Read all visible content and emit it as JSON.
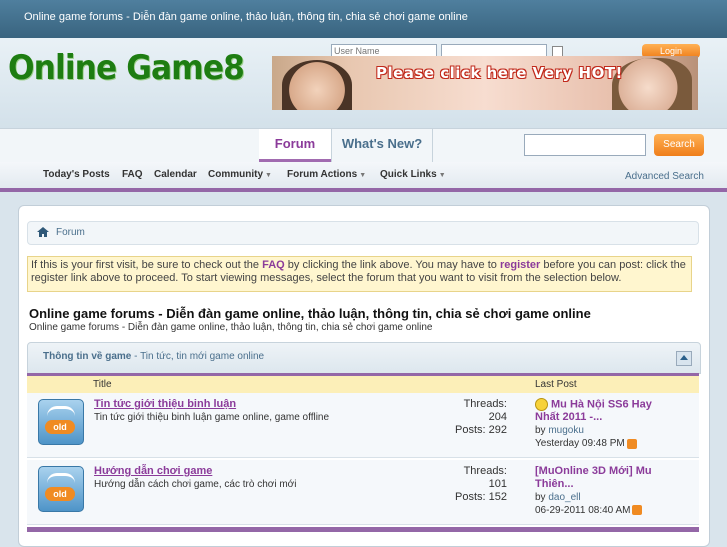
{
  "topbar": {
    "title": "Online game forums - Diễn đàn game online, thảo luận, thông tin, chia sẻ chơi game online"
  },
  "header": {
    "logo": "Online Game8",
    "username_placeholder": "User Name",
    "login_label": "Login",
    "banner_text": "Please click here Very HOT!"
  },
  "nav": {
    "tabs": [
      {
        "label": "Forum"
      },
      {
        "label": "What's New?"
      }
    ],
    "search_label": "Search",
    "subnav": [
      "Today's Posts",
      "FAQ",
      "Calendar",
      "Community",
      "Forum Actions",
      "Quick Links"
    ],
    "advanced_search": "Advanced Search"
  },
  "breadcrumb": {
    "label": "Forum"
  },
  "notice": {
    "part1": "If this is your first visit, be sure to check out the ",
    "faq": "FAQ",
    "part2": " by clicking the link above. You may have to ",
    "register": "register",
    "part3": " before you can post: click the register link above to proceed. To start viewing messages, select the forum that you want to visit from the selection below."
  },
  "page": {
    "title": "Online game forums - Diễn đàn game online, thảo luận, thông tin, chia sẻ chơi game online",
    "subtitle": "Online game forums - Diễn đàn game online, thảo luận, thông tin, chia sẻ chơi game online"
  },
  "category": {
    "name": "Thông tin về game",
    "separator": " - ",
    "desc": "Tin tức, tin mới game online"
  },
  "table": {
    "col_title": "Title",
    "col_last": "Last Post"
  },
  "forums": [
    {
      "icon_label": "old",
      "title": "Tin tức giới thiệu binh luận",
      "desc": "Tin tức giới thiệu binh luận game online, game offline",
      "threads_label": "Threads:",
      "threads": "204",
      "posts_label": "Posts:",
      "posts": "292",
      "last_title": "Mu Hà Nội SS6 Hay Nhất 2011 -...",
      "by_label": "by",
      "last_user": "mugoku",
      "last_date": "Yesterday",
      "last_time": "09:48 PM"
    },
    {
      "icon_label": "old",
      "title": "Hướng dẫn chơi game",
      "desc": "Hướng dẫn cách chơi game, các trò chơi mới",
      "threads_label": "Threads:",
      "threads": "101",
      "posts_label": "Posts:",
      "posts": "152",
      "last_title": "[MuOnline 3D Mới] Mu Thiên...",
      "by_label": "by",
      "last_user": "dao_ell",
      "last_date": "06-29-2011",
      "last_time": "08:40 AM"
    }
  ]
}
